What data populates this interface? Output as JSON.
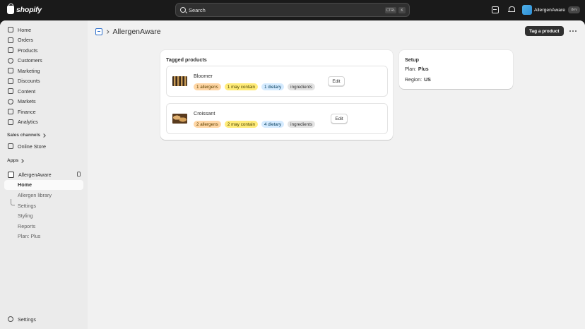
{
  "topbar": {
    "brand": "shopify",
    "search_placeholder": "Search",
    "shortcut_ctrl": "CTRL",
    "shortcut_key": "K",
    "account_name": "AllergenAware",
    "account_badge": "dev"
  },
  "sidebar": {
    "items": [
      {
        "label": "Home",
        "icon": "home-icon"
      },
      {
        "label": "Orders",
        "icon": "orders-icon"
      },
      {
        "label": "Products",
        "icon": "products-icon"
      },
      {
        "label": "Customers",
        "icon": "customers-icon"
      },
      {
        "label": "Marketing",
        "icon": "marketing-icon"
      },
      {
        "label": "Discounts",
        "icon": "discounts-icon"
      },
      {
        "label": "Content",
        "icon": "content-icon"
      },
      {
        "label": "Markets",
        "icon": "markets-icon"
      },
      {
        "label": "Finance",
        "icon": "finance-icon"
      },
      {
        "label": "Analytics",
        "icon": "analytics-icon"
      }
    ],
    "sales_channels_label": "Sales channels",
    "online_store_label": "Online Store",
    "apps_label": "Apps",
    "app_name": "AllergenAware",
    "app_subitems": [
      "Home",
      "Allergen library",
      "Settings",
      "Styling",
      "Reports",
      "Plan: Plus"
    ],
    "settings_label": "Settings"
  },
  "page": {
    "title": "AllergenAware",
    "primary_action": "Tag a product"
  },
  "tagged_products": {
    "title": "Tagged products",
    "products": [
      {
        "name": "Bloomer",
        "badges": [
          "1 allergens",
          "1 may contain",
          "1 dietary",
          "ingredients"
        ],
        "edit_label": "Edit"
      },
      {
        "name": "Croissant",
        "badges": [
          "2 allergens",
          "2 may contain",
          "4 dietary",
          "ingredients"
        ],
        "edit_label": "Edit"
      }
    ]
  },
  "setup": {
    "title": "Setup",
    "plan_label": "Plan:",
    "plan_value": "Plus",
    "region_label": "Region:",
    "region_value": "US"
  }
}
